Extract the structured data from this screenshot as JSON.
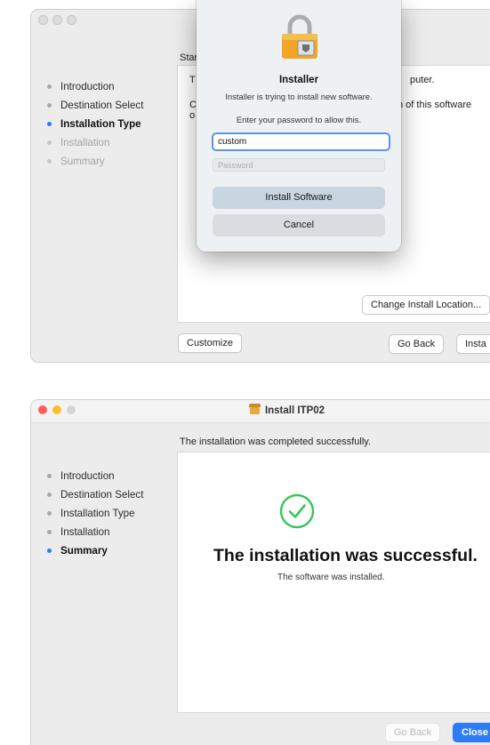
{
  "window1": {
    "sidebar": [
      {
        "label": "Introduction",
        "state": "done"
      },
      {
        "label": "Destination Select",
        "state": "done"
      },
      {
        "label": "Installation Type",
        "state": "active"
      },
      {
        "label": "Installation",
        "state": "pending"
      },
      {
        "label": "Summary",
        "state": "pending"
      }
    ],
    "heading_partial": "Star",
    "body_fragments": {
      "line1_left": "T",
      "line1_right": "puter.",
      "line2_left": "C",
      "line2_right": "n of this software",
      "line3_left": "o"
    },
    "buttons": {
      "change_location": "Change Install Location...",
      "customize": "Customize",
      "go_back": "Go Back",
      "install": "Insta"
    },
    "dialog": {
      "icon": "lock-icon",
      "title": "Installer",
      "message": "Installer is trying to install new software.",
      "prompt": "Enter your password to allow this.",
      "username_value": "custom",
      "password_placeholder": "Password",
      "install_button": "Install Software",
      "cancel_button": "Cancel"
    }
  },
  "window2": {
    "title": "Install ITP02",
    "title_icon": "package-icon",
    "heading": "The installation was completed successfully.",
    "sidebar": [
      {
        "label": "Introduction",
        "state": "done"
      },
      {
        "label": "Destination Select",
        "state": "done"
      },
      {
        "label": "Installation Type",
        "state": "done"
      },
      {
        "label": "Installation",
        "state": "done"
      },
      {
        "label": "Summary",
        "state": "active"
      }
    ],
    "success_icon": "checkmark-circle-icon",
    "success_title": "The installation was successful.",
    "success_subtitle": "The software was installed.",
    "buttons": {
      "go_back": "Go Back",
      "close": "Close"
    }
  },
  "colors": {
    "accent": "#2e7bf6",
    "success_green": "#34c759",
    "traffic_close": "#fe5f57",
    "traffic_min": "#febc2e",
    "traffic_max": "#c9c9c9"
  }
}
